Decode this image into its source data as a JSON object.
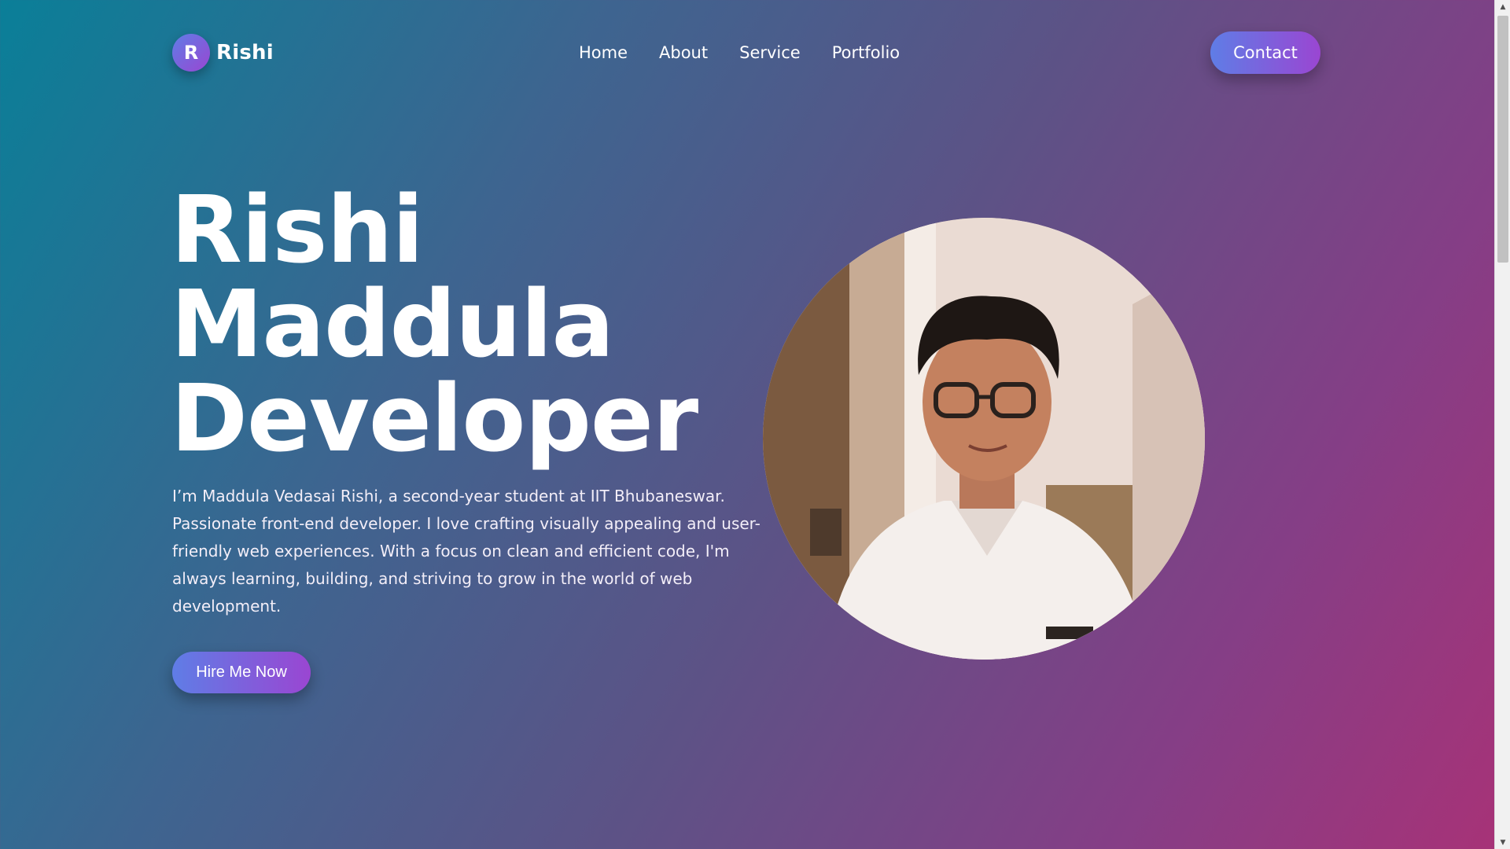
{
  "nav": {
    "logo_letter": "R",
    "brand": "Rishi",
    "links": [
      "Home",
      "About",
      "Service",
      "Portfolio"
    ],
    "contact_label": "Contact"
  },
  "hero": {
    "title_lines": [
      "Rishi",
      "Maddula",
      "Developer"
    ],
    "description": "I’m Maddula Vedasai Rishi, a second-year student at IIT Bhubaneswar. Passionate front-end developer. I love crafting visually appealing and user-friendly web experiences. With a focus on clean and efficient code, I'm always learning, building, and striving to grow in the world of web development.",
    "cta_label": "Hire Me Now"
  },
  "colors": {
    "gradient_start": "#0a7f98",
    "gradient_end": "#a83277",
    "button_start": "#5f7de6",
    "button_end": "#9a46d2"
  },
  "scrollbar": {
    "up_icon": "chevron-up-icon",
    "down_icon": "chevron-down-icon"
  }
}
